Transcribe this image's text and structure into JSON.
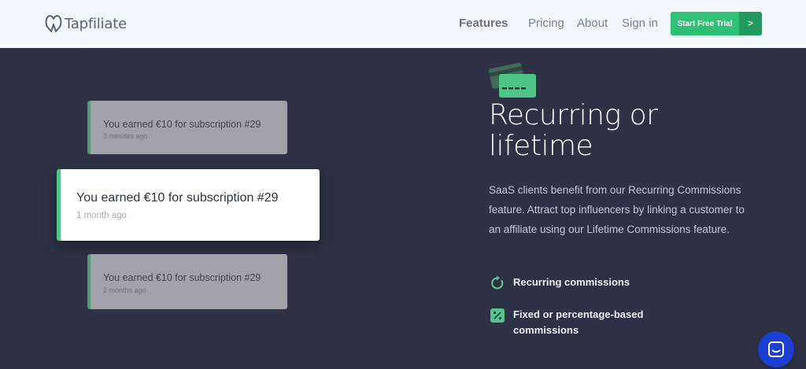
{
  "header": {
    "logo_text": "Tapfiliate",
    "nav": {
      "features": "Features",
      "pricing": "Pricing",
      "about": "About",
      "signin": "Sign in"
    },
    "cta_label": "Start Free Trial",
    "cta_arrow": ">"
  },
  "notifications": [
    {
      "message": "You earned €10 for subscription #29",
      "time": "3 minutes ago"
    },
    {
      "message": "You earned €10 for subscription #29",
      "time": "1 month ago"
    },
    {
      "message": "You earned €10 for subscription #29",
      "time": "2 months ago"
    }
  ],
  "feature": {
    "icon": "credit-card-icon",
    "title_line1": "Recurring or",
    "title_line2": "lifetime",
    "description": "SaaS clients benefit from our Recurring Commissions feature. Attract top influencers by linking a customer to an affiliate using our Lifetime Commissions feature.",
    "items": [
      {
        "icon": "refresh-icon",
        "label": "Recurring commissions"
      },
      {
        "icon": "percent-icon",
        "label_line1": "Fixed or percentage-based",
        "label_line2": "commissions"
      }
    ]
  },
  "chat_widget": {
    "icon": "chat-icon"
  },
  "colors": {
    "background": "#2e3244",
    "header_bg": "#f2f6fd",
    "accent_green": "#2fbf75",
    "chat_blue": "#1d3fd1"
  }
}
